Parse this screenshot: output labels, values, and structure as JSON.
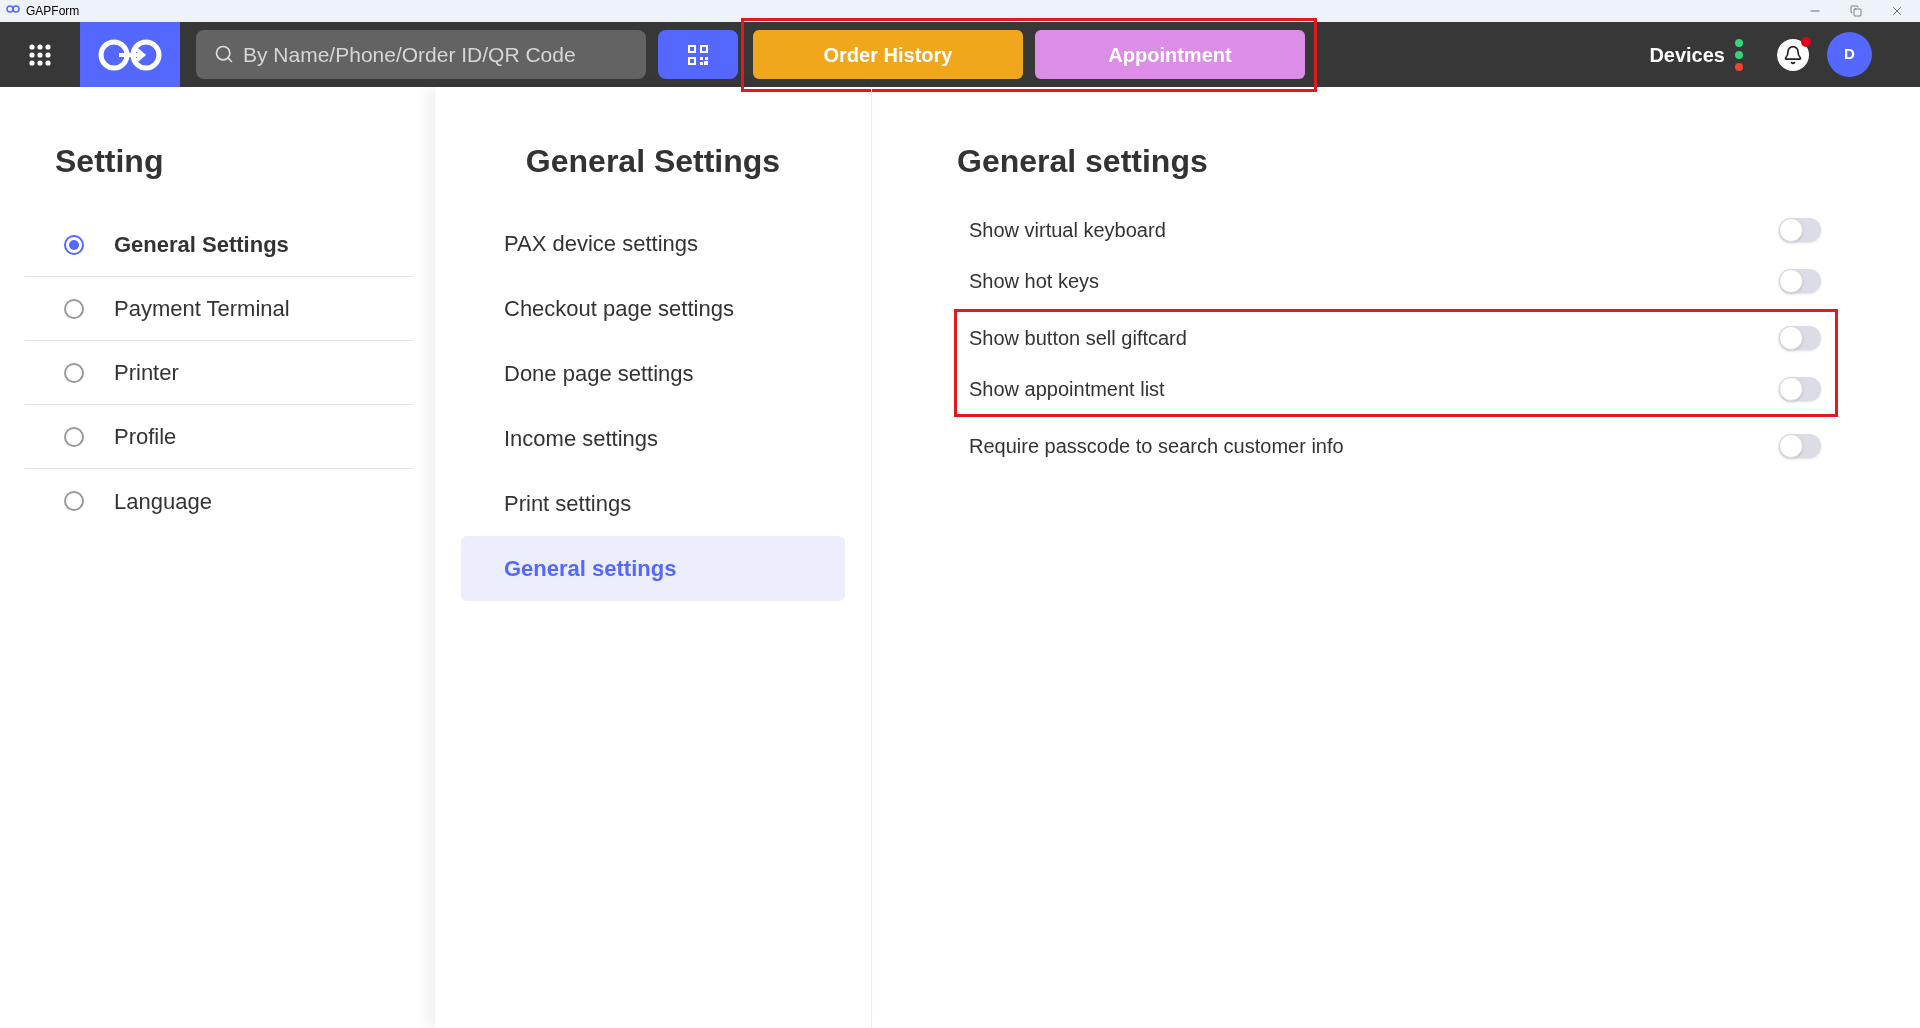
{
  "window": {
    "title": "GAPForm"
  },
  "topbar": {
    "search": {
      "placeholder": "By Name/Phone/Order ID/QR Code"
    },
    "highlighted": true,
    "buttons": [
      {
        "label": "Order History",
        "color": "#f0a71c"
      },
      {
        "label": "Appointment",
        "color": "#dc8ee6"
      }
    ],
    "devices": {
      "label": "Devices",
      "dots": [
        {
          "color": "#2fd87a"
        },
        {
          "color": "#2fd87a"
        },
        {
          "color": "#f2452e"
        }
      ]
    },
    "notifications": {
      "unread": true
    },
    "avatar": "D"
  },
  "sidebar": {
    "title": "Setting",
    "items": [
      {
        "label": "General Settings",
        "selected": true
      },
      {
        "label": "Payment Terminal",
        "selected": false
      },
      {
        "label": "Printer",
        "selected": false
      },
      {
        "label": "Profile",
        "selected": false
      },
      {
        "label": "Language",
        "selected": false
      }
    ]
  },
  "submenu": {
    "title": "General Settings",
    "items": [
      {
        "label": "PAX device settings",
        "selected": false
      },
      {
        "label": "Checkout page settings",
        "selected": false
      },
      {
        "label": "Done page settings",
        "selected": false
      },
      {
        "label": "Income settings",
        "selected": false
      },
      {
        "label": "Print settings",
        "selected": false
      },
      {
        "label": "General settings",
        "selected": true
      }
    ]
  },
  "content": {
    "title": "General settings",
    "groups": [
      {
        "highlighted": false,
        "items": [
          {
            "label": "Show virtual keyboard",
            "on": false
          },
          {
            "label": "Show hot keys",
            "on": false
          }
        ]
      },
      {
        "highlighted": true,
        "items": [
          {
            "label": "Show button sell giftcard",
            "on": false
          },
          {
            "label": "Show appointment list",
            "on": false
          }
        ]
      },
      {
        "highlighted": false,
        "items": [
          {
            "label": "Require passcode to search customer info",
            "on": false
          }
        ]
      }
    ]
  }
}
